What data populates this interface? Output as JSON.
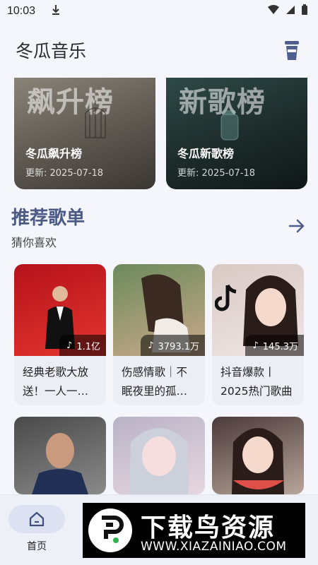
{
  "status": {
    "time": "10:03",
    "download_icon": "download-arrow-icon"
  },
  "header": {
    "title": "冬瓜音乐",
    "cup_icon": "cup-icon"
  },
  "charts": [
    {
      "bg_word": "飙升榜",
      "name": "冬瓜飙升榜",
      "date": "更新: 2025-07-18"
    },
    {
      "bg_word": "新歌榜",
      "name": "冬瓜新歌榜",
      "date": "更新: 2025-07-18"
    }
  ],
  "recommend": {
    "title": "推荐歌单",
    "subtitle": "猜你喜欢",
    "more_icon": "arrow-right-icon",
    "playlists": [
      {
        "count": "1.1亿",
        "title": "经典老歌大放送！一人一…",
        "colors": [
          "#b5121b",
          "#e3352f"
        ]
      },
      {
        "count": "3793.1万",
        "title": "伤感情歌｜不眠夜里的孤…",
        "colors": [
          "#6c8a5c",
          "#caa98a"
        ]
      },
      {
        "count": "145.3万",
        "title": "抖音爆款丨2025热门歌曲",
        "colors": [
          "#d8c9c4",
          "#f0e6e4"
        ]
      }
    ],
    "row2": [
      {
        "colors": [
          "#4a4a4a",
          "#8a8a8a"
        ]
      },
      {
        "colors": [
          "#b9b3c6",
          "#e7d7df"
        ]
      },
      {
        "colors": [
          "#4a3a3a",
          "#b9a59a"
        ]
      }
    ]
  },
  "nav": {
    "home_label": "首页"
  },
  "watermark": {
    "main": "下载鸟资源",
    "url": "WWW.XIAZAINIAO.COM"
  }
}
